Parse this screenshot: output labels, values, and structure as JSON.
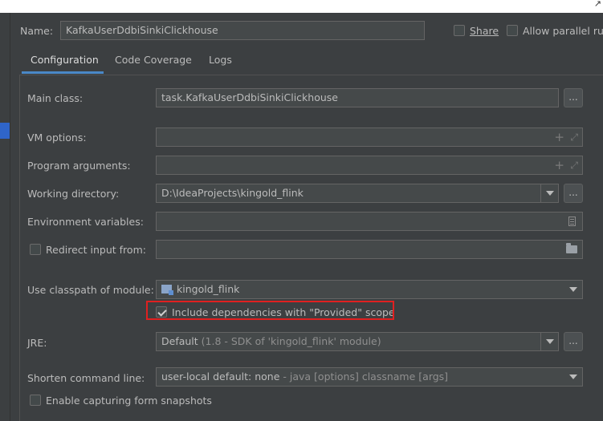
{
  "header": {
    "name_label": "Name:",
    "name_value": "KafkaUserDdbiSinkiClickhouse",
    "share_label": "Share",
    "parallel_label": "Allow parallel run"
  },
  "tabs": [
    {
      "label": "Configuration",
      "active": true
    },
    {
      "label": "Code Coverage",
      "active": false
    },
    {
      "label": "Logs",
      "active": false
    }
  ],
  "form": {
    "main_class_label": "Main class:",
    "main_class_value": "task.KafkaUserDdbiSinkiClickhouse",
    "browse_label": "...",
    "vm_options_label": "VM options:",
    "program_args_label": "Program arguments:",
    "working_dir_label": "Working directory:",
    "working_dir_value": "D:\\IdeaProjects\\kingold_flink",
    "env_vars_label": "Environment variables:",
    "redirect_label": "Redirect input from:",
    "classpath_label": "Use classpath of module:",
    "classpath_value": "kingold_flink",
    "include_deps_label": "Include dependencies with \"Provided\" scope",
    "jre_label": "JRE:",
    "jre_value_main": "Default",
    "jre_value_detail": " (1.8 - SDK of 'kingold_flink' module)",
    "shorten_label": "Shorten command line:",
    "shorten_value_main": "user-local default: none",
    "shorten_value_detail": " - java [options] classname [args]",
    "snapshots_label": "Enable capturing form snapshots"
  },
  "colors": {
    "accent": "#4a88c7",
    "highlight": "#e02020"
  }
}
